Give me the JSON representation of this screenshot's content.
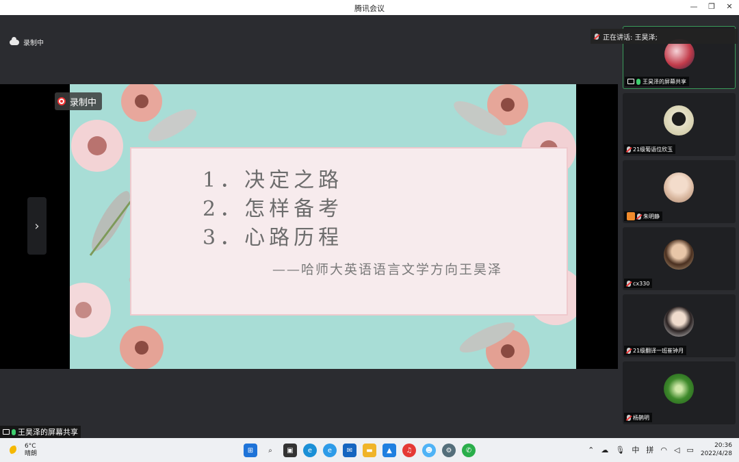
{
  "window": {
    "title": "腾讯会议"
  },
  "recording": {
    "top_label": "录制中",
    "badge_label": "录制中"
  },
  "slide": {
    "lines": [
      "1．决定之路",
      "2．怎样备考",
      "3．心路历程"
    ],
    "subtitle": "——哈师大英语语言文学方向王昊泽"
  },
  "share_label": "王昊泽的屏幕共享",
  "speaking": "正在讲话: 王昊泽;",
  "participants": [
    {
      "name": "王昊泽的屏幕共享",
      "active": true,
      "mic": "on",
      "avatar": "anime-avatar"
    },
    {
      "name": "21级葡语位欣玉",
      "active": false,
      "mic": "muted",
      "avatar": "penguin-avatar"
    },
    {
      "name": "朱明静",
      "active": false,
      "mic": "muted",
      "host": true,
      "avatar": "girl-avatar"
    },
    {
      "name": "cx330",
      "active": false,
      "mic": "muted",
      "avatar": "woman-avatar"
    },
    {
      "name": "21级翻译一班崔钟月",
      "active": false,
      "mic": "muted",
      "avatar": "woman2-avatar"
    },
    {
      "name": "杨鹊明",
      "active": false,
      "mic": "muted",
      "avatar": "nature-avatar"
    }
  ],
  "taskbar": {
    "weather_temp": "6°C",
    "weather_desc": "晴朗",
    "ime_lang": "中",
    "ime_mode": "拼",
    "time": "20:36",
    "date": "2022/4/28"
  },
  "colors": {
    "accent": "#3a9c5a",
    "slide_bg": "#a8ddd6",
    "panel_bg": "#f7ebed"
  }
}
